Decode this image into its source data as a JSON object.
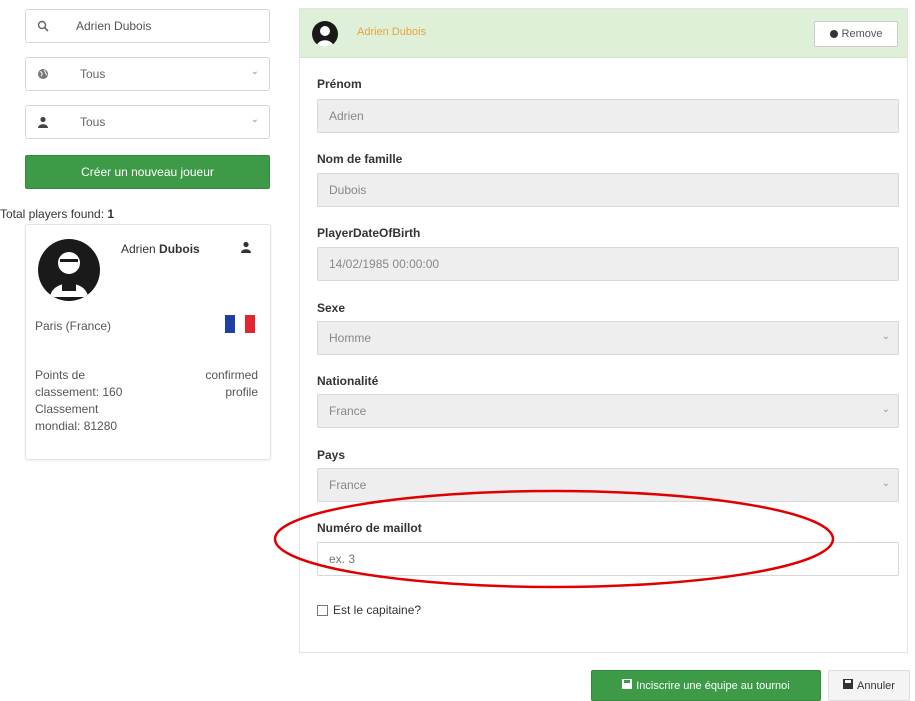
{
  "filters": {
    "search": {
      "value": "Adrien Dubois",
      "icon": "search-icon"
    },
    "select_one": {
      "value": "Tous",
      "icon": "globe-icon"
    },
    "select_two": {
      "value": "Tous",
      "icon": "user-icon"
    }
  },
  "create_button": {
    "label": "Créer un nouveau joueur"
  },
  "results": {
    "label": "Total players found:",
    "count": "1"
  },
  "player_card": {
    "first_name": "Adrien",
    "last_name": "Dubois",
    "location": "Paris (France)",
    "points_line1": "Points de",
    "points_line2": "classement: 160",
    "rank_line1": "Classement",
    "rank_line2": "mondial: 81280",
    "status_line1": "confirmed",
    "status_line2": "profile",
    "flag_colors": [
      "#1f3fa3",
      "#ffffff",
      "#e3252f"
    ]
  },
  "panel": {
    "title": "Adrien Dubois",
    "remove_label": "Remove",
    "fields": {
      "first_name_label": "Prénom",
      "first_name_value": "Adrien",
      "last_name_label": "Nom de famille",
      "last_name_value": "Dubois",
      "dob_label": "PlayerDateOfBirth",
      "dob_value": "14/02/1985 00:00:00",
      "sex_label": "Sexe",
      "sex_value": "Homme",
      "nationality_label": "Nationalité",
      "nationality_value": "France",
      "country_label": "Pays",
      "country_value": "France",
      "jersey_label": "Numéro de maillot",
      "jersey_placeholder": "ex. 3",
      "captain_label": "Est le capitaine?"
    }
  },
  "actions": {
    "submit_label": "Inciscrire une équipe au tournoi",
    "cancel_label": "Annuler"
  },
  "colors": {
    "green": "#3d9a46",
    "panel_header": "#dff0d8",
    "highlight_circle": "#e00000",
    "title_orange": "#e8a33d"
  }
}
